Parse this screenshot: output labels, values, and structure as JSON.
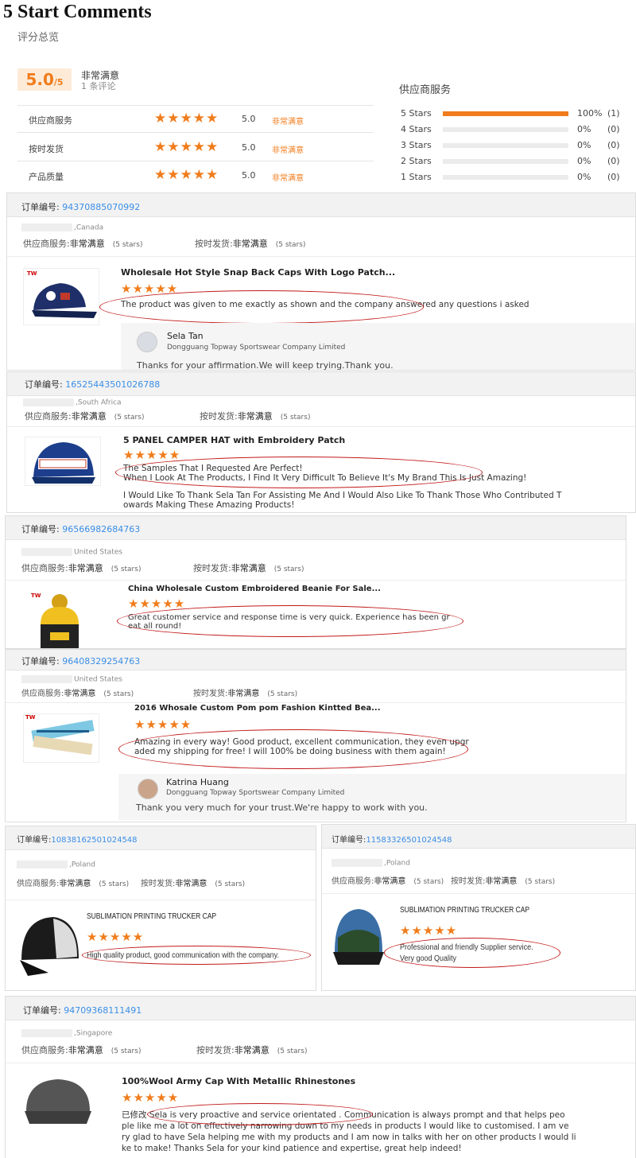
{
  "page_title": "5 Start Comments",
  "summary": {
    "label": "评分总览",
    "score": "5.0",
    "score_den": "/5",
    "satisfaction": "非常满意",
    "review_count": "1 条评论",
    "rows": [
      {
        "label": "供应商服务",
        "value": "5.0",
        "text": "非常满意"
      },
      {
        "label": "按时发货",
        "value": "5.0",
        "text": "非常满意"
      },
      {
        "label": "产品质量",
        "value": "5.0",
        "text": "非常满意"
      }
    ],
    "service_title": "供应商服务",
    "histogram": [
      {
        "label": "5 Stars",
        "fraction": 1.0,
        "pct": "100%",
        "count": "(1)"
      },
      {
        "label": "4 Stars",
        "fraction": 0,
        "pct": "0%",
        "count": "(0)"
      },
      {
        "label": "3 Stars",
        "fraction": 0,
        "pct": "0%",
        "count": "(0)"
      },
      {
        "label": "2 Stars",
        "fraction": 0,
        "pct": "0%",
        "count": "(0)"
      },
      {
        "label": "1 Stars",
        "fraction": 0,
        "pct": "0%",
        "count": "(0)"
      }
    ]
  },
  "stars_glyph": "★★★★★",
  "order_label": "订单编号:",
  "service_label": "供应商服务:",
  "delivery_label": "按时发货:",
  "very_satisfied": "非常满意",
  "five_stars": "(5 stars)",
  "reviews": [
    {
      "order": "94370885070992",
      "country": ",Canada",
      "product": "Wholesale Hot Style Snap Back Caps With Logo Patch...",
      "comment": [
        "The product was given to me exactly as shown and the company answered any questions i asked"
      ],
      "reply": {
        "name": "Sela Tan",
        "company": "Dongguang Topway Sportswear Company Limited",
        "text": "Thanks for your affirmation.We will keep trying.Thank you."
      }
    },
    {
      "order": "16525443501026788",
      "country": ",South Africa",
      "product": "5 PANEL CAMPER HAT with Embroidery Patch",
      "comment": [
        "The Samples That I Requested Are Perfect!",
        "When I Look At The Products, I Find It Very Difficult To Believe It's My Brand This Is Just Amazing!"
      ],
      "comment2": [
        "I Would Like To Thank Sela Tan For Assisting Me And I Would Also Like To Thank Those Who Contributed T",
        "owards Making These Amazing Products!"
      ]
    },
    {
      "order": "96566982684763",
      "country": "United States",
      "product": "China Wholesale Custom Embroidered Beanie For Sale...",
      "comment": [
        "Great customer service and response time is very quick. Experience has been gr",
        "eat all round!"
      ]
    },
    {
      "order": "96408329254763",
      "country": "United States",
      "product": "2016 Whosale Custom Pom pom Fashion Kintted Bea...",
      "comment": [
        "Amazing in every way! Good product, excellent communication, they even upgr",
        "aded my shipping for free! I will 100% be doing business with them again!"
      ],
      "reply": {
        "name": "Katrina Huang",
        "company": "Dongguang Topway Sportswear Company Limited",
        "text": "Thank you very much for your trust.We're happy to work with you."
      }
    },
    {
      "order": "10838162501024548",
      "country": ",Poland",
      "product": "SUBLIMATION PRINTING TRUCKER CAP",
      "comment": [
        "High quality product, good communication with the company."
      ]
    },
    {
      "order": "11583326501024548",
      "country": ",Poland",
      "product": "SUBLIMATION PRINTING TRUCKER CAP",
      "comment": [
        "Professional and friendly Supplier service.",
        "Very good Quality"
      ]
    },
    {
      "order": "94709368111491",
      "country": ",Singapore",
      "product": "100%Wool Army Cap With Metallic Rhinestones",
      "comment": [
        "已修改 Sela is very proactive and service orientated . Communication is always prompt and that helps peo",
        "ple like me a lot on effectively narrowing down to my needs in products I would like to customised.  I am ve",
        "ry glad to have Sela helping me with my products and I am now in talks with her on other products I would li",
        "ke to make!  Thanks Sela for your kind patience and expertise, great help indeed!"
      ]
    }
  ],
  "colors": {
    "accent": "#f07c1c",
    "link": "#3a8ee6",
    "highlight_oval": "#c21a1a"
  }
}
